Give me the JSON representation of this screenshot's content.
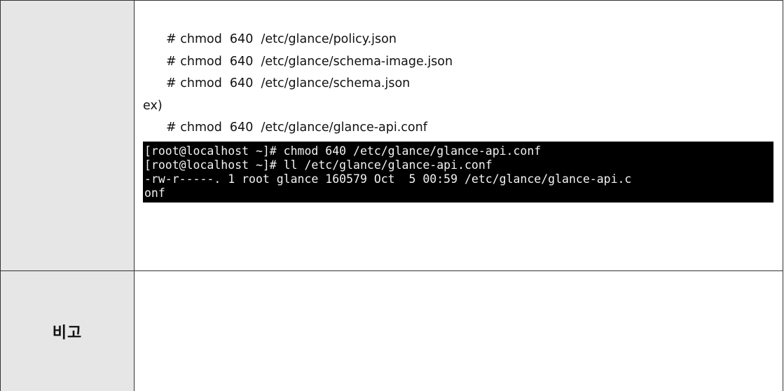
{
  "commands": [
    "# chmod  640  /etc/glance/policy.json",
    "# chmod  640  /etc/glance/schema-image.json",
    "# chmod  640  /etc/glance/schema.json"
  ],
  "example_label": "ex)",
  "example_command": "# chmod  640  /etc/glance/glance-api.conf",
  "terminal": {
    "lines": [
      "[root@localhost ~]# chmod 640 /etc/glance/glance-api.conf",
      "[root@localhost ~]# ll /etc/glance/glance-api.conf",
      "-rw-r-----. 1 root glance 160579 Oct  5 00:59 /etc/glance/glance-api.c",
      "onf"
    ]
  },
  "remark_label": "비고"
}
